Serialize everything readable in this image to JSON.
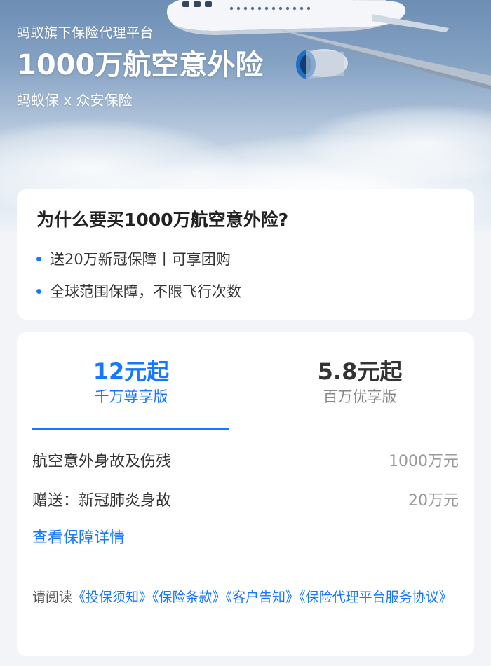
{
  "hero": {
    "platform": "蚂蚁旗下保险代理平台",
    "title": "1000万航空意外险",
    "partner": "蚂蚁保 x 众安保险",
    "image": "airplane-above-clouds"
  },
  "why": {
    "title": "为什么要买1000万航空意外险?",
    "items": [
      "送20万新冠保障丨可享团购",
      "全球范围保障，不限飞行次数"
    ]
  },
  "plans": {
    "tabs": [
      {
        "price": "12元起",
        "name": "千万尊享版",
        "selected": true
      },
      {
        "price": "5.8元起",
        "name": "百万优享版",
        "selected": false
      }
    ],
    "coverage": [
      {
        "name": "航空意外身故及伤残",
        "amount": "1000万元"
      },
      {
        "name": "赠送：新冠肺炎身故",
        "amount": "20万元"
      }
    ],
    "detail_link": "查看保障详情"
  },
  "agreement": {
    "prefix": "请阅读",
    "links": [
      "《投保须知》",
      "《保险条款》",
      "《客户告知》",
      "《保险代理平台服务协议》"
    ]
  },
  "colors": {
    "accent": "#1677ff",
    "text_primary": "#222222",
    "text_secondary": "#999999",
    "background": "#f2f4f7"
  }
}
